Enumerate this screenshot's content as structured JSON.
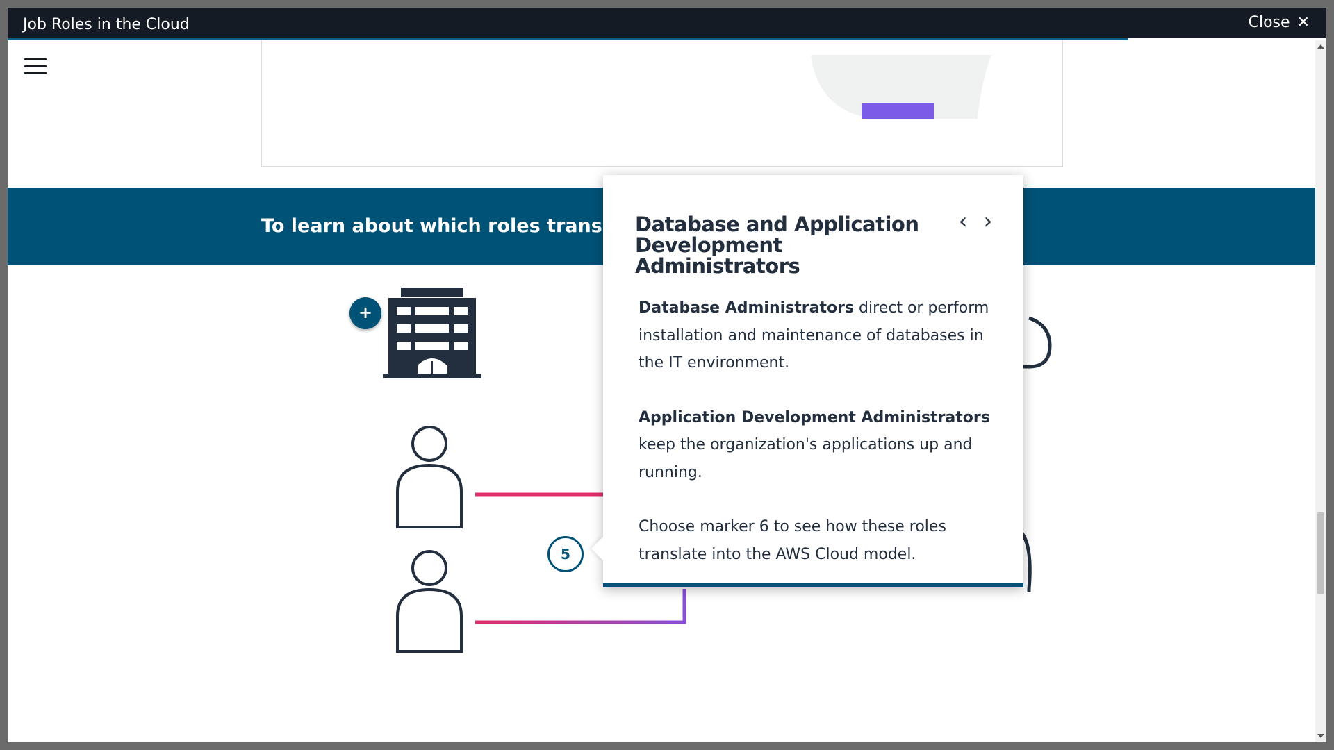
{
  "window": {
    "title": "Job Roles in the Cloud",
    "close_label": "Close",
    "close_icon": "close-icon"
  },
  "menu": {
    "icon": "hamburger-menu-icon"
  },
  "banner": {
    "text": "To learn about which roles translate to D"
  },
  "markers": {
    "plus": "+",
    "active": "5"
  },
  "popover": {
    "title": "Database and Application Development Administrators",
    "prev_icon": "chevron-left-icon",
    "next_icon": "chevron-right-icon",
    "paragraphs": [
      {
        "bold": "Database Administrators",
        "text": " direct or perform installation and maintenance of databases in the IT environment."
      },
      {
        "bold": "Application Development Administrators",
        "text": " keep the organization's applications up and running."
      },
      {
        "bold": "",
        "text": "Choose marker 6 to see how these roles translate into the AWS Cloud model."
      }
    ]
  },
  "colors": {
    "titlebar": "#151b24",
    "banner": "#005276",
    "accent_purple": "#7b5ce8",
    "line_pink": "#e0306a",
    "icon_dark": "#232f3e"
  }
}
